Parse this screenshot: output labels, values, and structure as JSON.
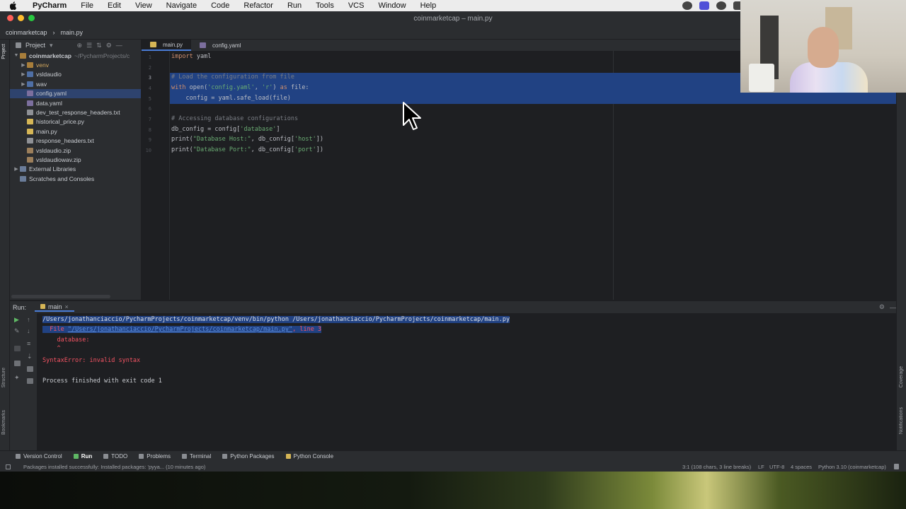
{
  "menubar": {
    "app": "PyCharm",
    "items": [
      "File",
      "Edit",
      "View",
      "Navigate",
      "Code",
      "Refactor",
      "Run",
      "Tools",
      "VCS",
      "Window",
      "Help"
    ]
  },
  "window": {
    "title": "coinmarketcap – main.py"
  },
  "navbar": {
    "project": "coinmarketcap",
    "file": "main.py"
  },
  "project_panel": {
    "label": "Project",
    "root": "coinmarketcap",
    "root_path": "~/PycharmProjects/c",
    "items": [
      {
        "label": "venv",
        "kind": "folder",
        "depth": 1
      },
      {
        "label": "vsldaudio",
        "kind": "folder-blue",
        "depth": 1
      },
      {
        "label": "wav",
        "kind": "folder",
        "depth": 1
      },
      {
        "label": "config.yaml",
        "kind": "yaml",
        "depth": 1
      },
      {
        "label": "data.yaml",
        "kind": "yaml",
        "depth": 1
      },
      {
        "label": "dev_test_response_headers.txt",
        "kind": "txt",
        "depth": 1
      },
      {
        "label": "historical_price.py",
        "kind": "py",
        "depth": 1
      },
      {
        "label": "main.py",
        "kind": "py",
        "depth": 1
      },
      {
        "label": "response_headers.txt",
        "kind": "txt",
        "depth": 1
      },
      {
        "label": "vsldaudio.zip",
        "kind": "zip",
        "depth": 1
      },
      {
        "label": "vsldaudiowav.zip",
        "kind": "zip",
        "depth": 1
      }
    ],
    "external": "External Libraries",
    "scratches": "Scratches and Consoles"
  },
  "editor": {
    "tabs": [
      {
        "label": "main.py",
        "active": true
      },
      {
        "label": "config.yaml",
        "active": false
      }
    ],
    "line_numbers": [
      "1",
      "2",
      "3",
      "4",
      "5",
      "6",
      "7",
      "8",
      "9",
      "10"
    ],
    "lines": {
      "l1_kw": "import",
      "l1_rest": " yaml",
      "l3": "# Load the configuration from file",
      "l4_kw": "with",
      "l4_fn": " open(",
      "l4_s1": "'config.yaml'",
      "l4_c": ", ",
      "l4_s2": "'r'",
      "l4_p": ") ",
      "l4_as": "as",
      "l4_rest": " file:",
      "l5": "    config = yaml.safe_load(file)",
      "l7": "# Accessing database configurations",
      "l8_a": "db_config = config[",
      "l8_s": "'database'",
      "l8_b": "]",
      "l9_a": "print(",
      "l9_s1": "\"Database Host:\"",
      "l9_b": ", db_config[",
      "l9_s2": "'host'",
      "l9_c": "])",
      "l10_a": "print(",
      "l10_s1": "\"Database Port:\"",
      "l10_b": ", db_config[",
      "l10_s2": "'port'",
      "l10_c": "])"
    }
  },
  "run_panel": {
    "label": "Run:",
    "config": "main",
    "output": {
      "cmd": "/Users/jonathanciaccio/PycharmProjects/coinmarketcap/venv/bin/python /Users/jonathanciaccio/PycharmProjects/coinmarketcap/main.py",
      "file_prefix": "  File ",
      "file_path": "\"/Users/jonathanciaccio/PycharmProjects/coinmarketcap/main.py\"",
      "file_suffix": ", line 3",
      "database": "    database:",
      "caret": "    ^",
      "error": "SyntaxError: invalid syntax",
      "finished": "Process finished with exit code 1"
    }
  },
  "bottom_tabs": [
    "Version Control",
    "Run",
    "TODO",
    "Problems",
    "Terminal",
    "Python Packages",
    "Python Console"
  ],
  "bottom_active": "Run",
  "side_labels": {
    "project": "Project",
    "structure": "Structure",
    "bookmarks": "Bookmarks",
    "coverage": "Coverage",
    "notifications": "Notifications"
  },
  "status": {
    "message": "Packages installed successfully: Installed packages: 'pyya... (10 minutes ago)",
    "position": "3:1 (108 chars, 3 line breaks)",
    "line_sep": "LF",
    "encoding": "UTF-8",
    "indent": "4 spaces",
    "interpreter": "Python 3.10 (coinmarketcap)"
  },
  "colors": {
    "selection": "#214283",
    "error": "#f75464",
    "accent": "#4a7cd6"
  }
}
